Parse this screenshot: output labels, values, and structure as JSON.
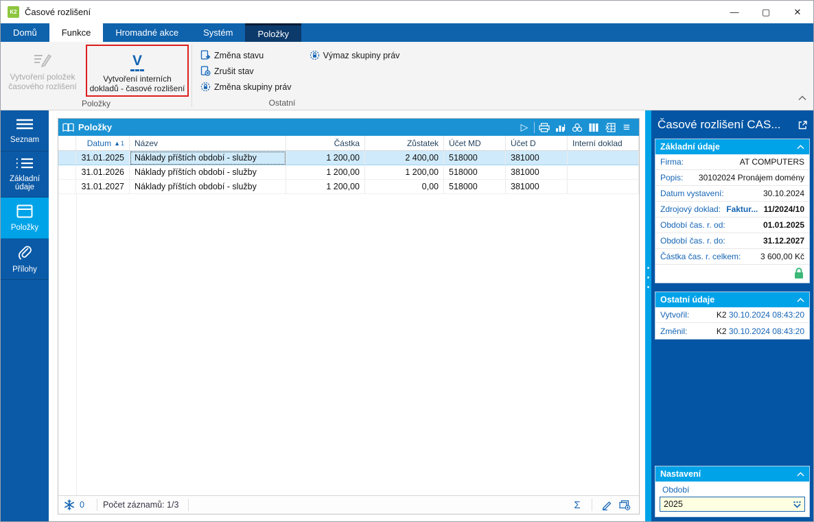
{
  "window": {
    "title": "Časové rozlišení",
    "app_logo": "K2"
  },
  "icons": {
    "minimize": "—",
    "maximize": "▢",
    "close": "✕",
    "play": "▷",
    "menu": "≡",
    "sigma": "Σ"
  },
  "colors": {
    "tabbar_blue": "#0f62ac",
    "context_tab_navy": "#0c3a6b",
    "sidebar_blue": "#0b5aa7",
    "active_cyan": "#00a3e8",
    "table_header_blue": "#1b92d4",
    "panel_blue": "#0455a4",
    "section_cyan": "#00a2e8",
    "label_blue": "#1464b4",
    "selected_row": "#cfeafa",
    "highlight_red": "#dd1d1d",
    "input_yellow": "#ffffe1",
    "lock_green": "#3cb878",
    "logo_green": "#8dc63f"
  },
  "tabs": [
    {
      "label": "Domů"
    },
    {
      "label": "Funkce"
    },
    {
      "label": "Hromadné akce"
    },
    {
      "label": "Systém"
    },
    {
      "label": "Položky"
    }
  ],
  "ribbon": {
    "group_polozky": "Položky",
    "group_ostatni": "Ostatní",
    "create_items": {
      "line1": "Vytvoření položek",
      "line2": "časového rozlišení"
    },
    "create_internal": {
      "glyph": "V",
      "line1": "Vytvoření interních",
      "line2": "dokladů - časové rozlišení"
    },
    "actions": [
      "Změna stavu",
      "Zrušit stav",
      "Změna skupiny práv",
      "Výmaz skupiny práv"
    ]
  },
  "sidebar": {
    "items": [
      {
        "label": "Seznam"
      },
      {
        "label": "Základní údaje"
      },
      {
        "label": "Položky"
      },
      {
        "label": "Přílohy"
      }
    ]
  },
  "table": {
    "title": "Položky",
    "sort_marker": "▲",
    "sort_order": "1",
    "columns": [
      "Datum",
      "Název",
      "Částka",
      "Zůstatek",
      "Účet MD",
      "Účet D",
      "Interní doklad"
    ],
    "rows": [
      {
        "datum": "31.01.2025",
        "nazev": "Náklady příštích období - služby",
        "castka": "1 200,00",
        "zustatek": "2 400,00",
        "ucet_md": "518000",
        "ucet_d": "381000",
        "interni": ""
      },
      {
        "datum": "31.01.2026",
        "nazev": "Náklady příštích období - služby",
        "castka": "1 200,00",
        "zustatek": "1 200,00",
        "ucet_md": "518000",
        "ucet_d": "381000",
        "interni": ""
      },
      {
        "datum": "31.01.2027",
        "nazev": "Náklady příštích období - služby",
        "castka": "1 200,00",
        "zustatek": "0,00",
        "ucet_md": "518000",
        "ucet_d": "381000",
        "interni": ""
      }
    ],
    "status": {
      "counter": "0",
      "records": "Počet záznamů: 1/3"
    }
  },
  "detail": {
    "title": "Časové rozlišení CAS...",
    "basic": {
      "header": "Základní údaje",
      "fields": [
        {
          "label": "Firma:",
          "value": "AT COMPUTERS"
        },
        {
          "label": "Popis:",
          "value": "30102024 Pronájem domény"
        },
        {
          "label": "Datum vystavení:",
          "value": "30.10.2024"
        },
        {
          "label": "Zdrojový doklad:",
          "link": "Faktur...",
          "value": "11/2024/10"
        },
        {
          "label": "Období čas. r. od:",
          "value": "01.01.2025"
        },
        {
          "label": "Období čas. r. do:",
          "value": "31.12.2027"
        },
        {
          "label": "Částka čas. r. celkem:",
          "value": "3 600,00 Kč"
        }
      ]
    },
    "other": {
      "header": "Ostatní údaje",
      "fields": [
        {
          "label": "Vytvořil:",
          "user": "K2",
          "datetime": "30.10.2024 08:43:20"
        },
        {
          "label": "Změnil:",
          "user": "K2",
          "datetime": "30.10.2024 08:43:20"
        }
      ]
    },
    "settings": {
      "header": "Nastavení",
      "label": "Období",
      "value": "2025"
    }
  }
}
